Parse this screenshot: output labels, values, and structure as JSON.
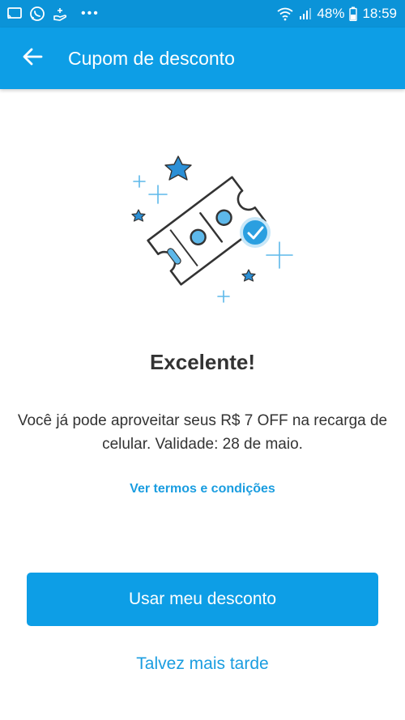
{
  "status_bar": {
    "left_icons": [
      "cast-icon",
      "whatsapp-icon",
      "hand-icon"
    ],
    "overflow": "•••",
    "battery_percent": "48%",
    "time": "18:59"
  },
  "app_bar": {
    "title": "Cupom de desconto",
    "back_icon": "arrow-left-icon"
  },
  "illustration": {
    "icon": "discount-ticket-icon",
    "accent_color": "#2a9fe0",
    "line_color": "#333333"
  },
  "content": {
    "headline": "Excelente!",
    "message": "Você já pode aproveitar seus R$ 7 OFF na recarga de celular. Validade: 28 de maio.",
    "terms_link": "Ver termos e condições"
  },
  "actions": {
    "primary": "Usar meu desconto",
    "secondary": "Talvez mais tarde"
  },
  "colors": {
    "app_bar": "#0d9ee6",
    "status_bar": "#0b93d8",
    "link": "#1a9de0",
    "text": "#333333"
  }
}
